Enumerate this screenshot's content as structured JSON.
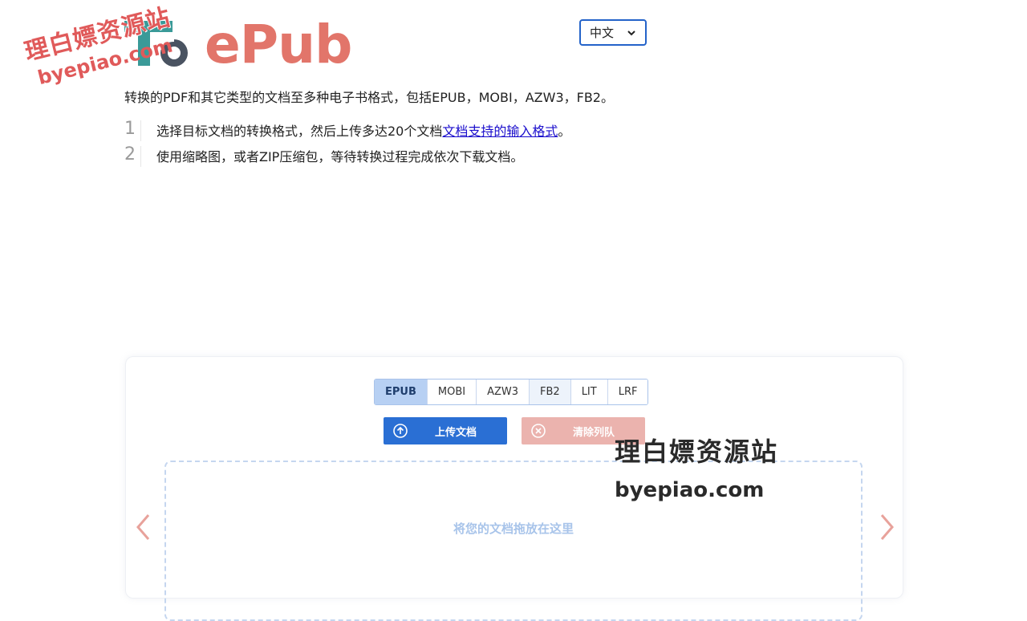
{
  "logo": {
    "text": "ePub"
  },
  "language": {
    "selected": "中文"
  },
  "intro": "转换的PDF和其它类型的文档至多种电子书格式，包括EPUB，MOBI，AZW3，FB2。",
  "steps": [
    {
      "num": "1",
      "text": "选择目标文档的转换格式，然后上传多达20个文档",
      "link": "文档支持的输入格式",
      "suffix": "。"
    },
    {
      "num": "2",
      "text": "使用缩略图，或者ZIP压缩包，等待转换过程完成依次下载文档。"
    }
  ],
  "converter": {
    "formats": [
      "EPUB",
      "MOBI",
      "AZW3",
      "FB2",
      "LIT",
      "LRF"
    ],
    "upload_label": "上传文档",
    "clear_label": "清除列队",
    "drop_text": "将您的文档拖放在这里"
  },
  "watermark": {
    "cn": "理白嫖资源站",
    "en": "byepiao.com"
  },
  "colors": {
    "accent": "#2a6fd4",
    "brand": "#e2756a",
    "logo_teal": "#3a9a98"
  }
}
